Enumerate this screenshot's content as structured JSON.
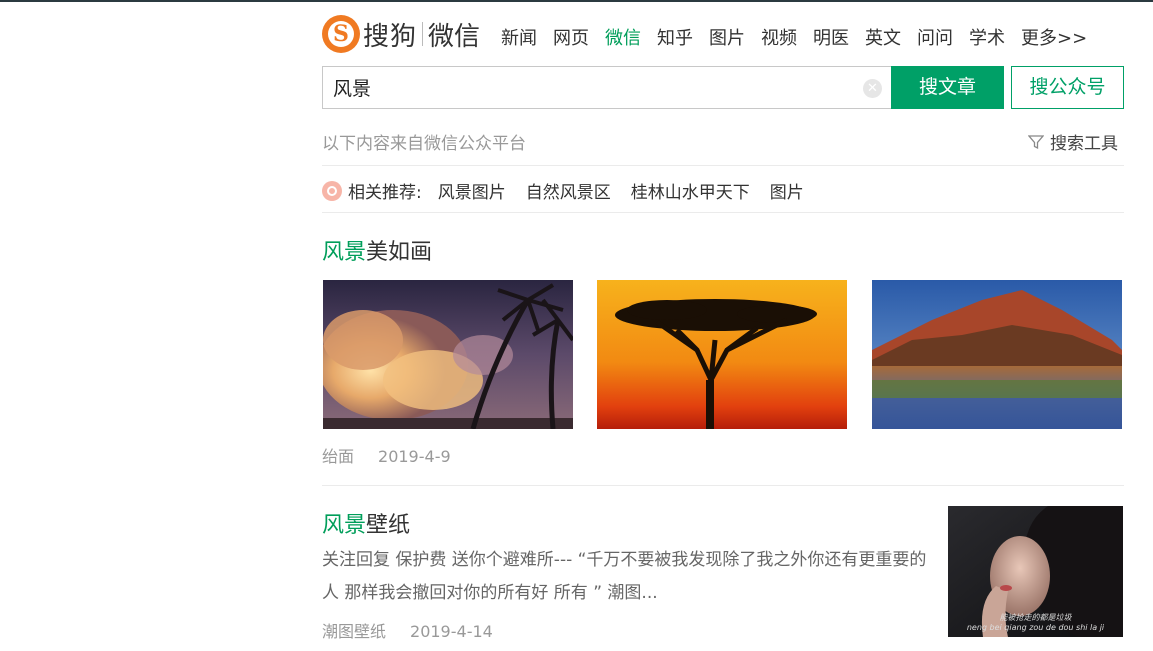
{
  "logo": {
    "badge": "S",
    "name": "搜狗",
    "product": "微信"
  },
  "nav": [
    "新闻",
    "网页",
    "微信",
    "知乎",
    "图片",
    "视频",
    "明医",
    "英文",
    "问问",
    "学术",
    "更多>>"
  ],
  "nav_active_index": 2,
  "search": {
    "value": "风景",
    "btn_article": "搜文章",
    "btn_account": "搜公众号"
  },
  "source_note": "以下内容来自微信公众平台",
  "tools_label": "搜索工具",
  "related": {
    "label": "相关推荐:",
    "items": [
      "风景图片",
      "自然风景区",
      "桂林山水甲天下",
      "图片"
    ]
  },
  "results": [
    {
      "title_highlight": "风景",
      "title_rest": "美如画",
      "source": "绐面",
      "date": "2019-4-9"
    },
    {
      "title_highlight": "风景",
      "title_rest": "壁纸",
      "snippet": "关注回复 保护费 送你个避难所--- “千万不要被我发现除了我之外你还有更重要的人 那样我会撤回对你的所有好 所有 ” 潮图...",
      "source": "潮图壁纸",
      "date": "2019-4-14",
      "image_caption_line1": "能被抢走的都是垃圾",
      "image_caption_line2": "neng bei qiang zou de dou shi la ji"
    }
  ],
  "colors": {
    "accent": "#00a067",
    "logo": "#f07a22"
  }
}
